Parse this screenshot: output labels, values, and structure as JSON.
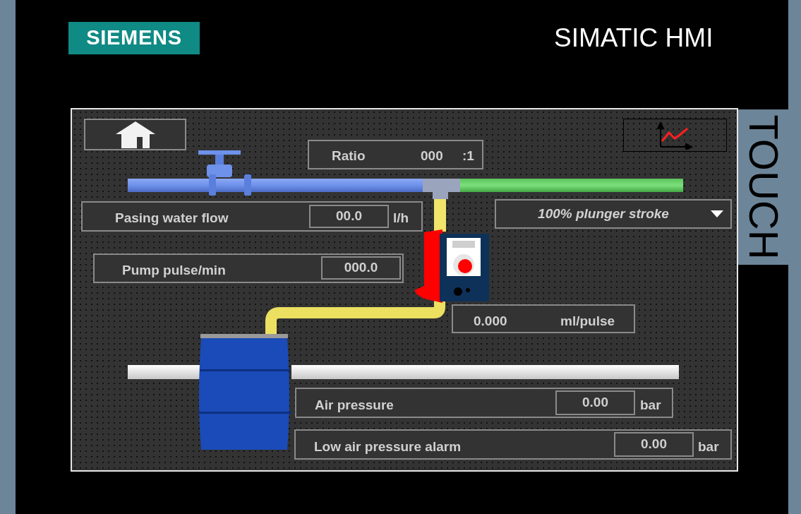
{
  "header": {
    "logo": "SIEMENS",
    "title": "SIMATIC HMI",
    "side_label": "TOUCH"
  },
  "ratio": {
    "label": "Ratio",
    "value": "000",
    "unit": ":1"
  },
  "water_flow": {
    "label": "Pasing water flow",
    "value": "00.0",
    "unit": "l/h"
  },
  "stroke_dropdown": {
    "value": "100% plunger stroke"
  },
  "pump_pulse": {
    "label": "Pump pulse/min",
    "value": "000.0"
  },
  "dose": {
    "value": "0.000",
    "unit": "ml/pulse"
  },
  "air_pressure": {
    "label": "Air pressure",
    "value": "0.00",
    "unit": "bar"
  },
  "low_air_alarm": {
    "label": "Low air pressure alarm",
    "value": "0.00",
    "unit": "bar"
  }
}
